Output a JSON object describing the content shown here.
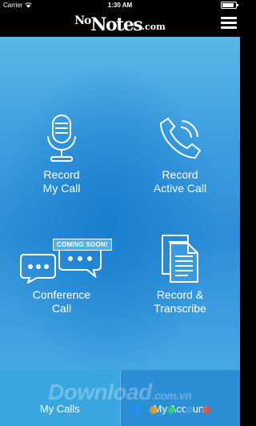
{
  "status": {
    "carrier": "Carrier",
    "time": "1:30 AM"
  },
  "header": {
    "logo_no": "No",
    "logo_notes": "Notes",
    "logo_com": ".com"
  },
  "tiles": {
    "record_my_call": "Record\nMy Call",
    "record_active_call": "Record\nActive Call",
    "conference_call": "Conference\nCall",
    "coming_soon": "COMING SOON!",
    "record_transcribe": "Record &\nTranscribe"
  },
  "tabs": {
    "calls": "My Calls",
    "account": "My Account"
  },
  "watermark": {
    "main": "Download",
    "domain": ".com.vn"
  },
  "colors": {
    "background_top": "#5ab7e6",
    "background_mid": "#2d8ed8",
    "header": "#000000",
    "watermark_dots": [
      "#1e90ff",
      "#f39c12",
      "#2ecc71",
      "#3498db",
      "#e74c3c"
    ]
  },
  "icons": {
    "menu": "hamburger-icon",
    "record_my_call": "microphone-icon",
    "record_active_call": "phone-handset-icon",
    "conference_call": "chat-bubbles-icon",
    "record_transcribe": "documents-icon"
  }
}
